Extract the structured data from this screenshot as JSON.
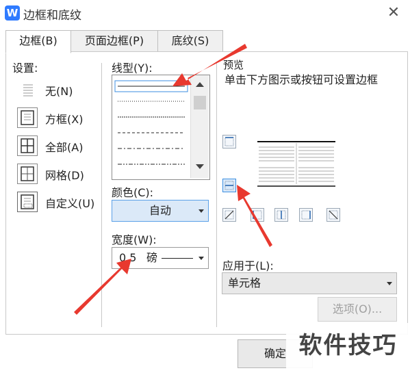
{
  "window": {
    "title": "边框和底纹",
    "app_icon_letter": "W"
  },
  "tabs": [
    {
      "label": "边框(B)",
      "active": true
    },
    {
      "label": "页面边框(P)",
      "active": false
    },
    {
      "label": "底纹(S)",
      "active": false
    }
  ],
  "settings": {
    "label": "设置:",
    "items": [
      {
        "label": "无(N)",
        "icon": "none-border-icon"
      },
      {
        "label": "方框(X)",
        "icon": "box-border-icon"
      },
      {
        "label": "全部(A)",
        "icon": "all-border-icon"
      },
      {
        "label": "网格(D)",
        "icon": "grid-border-icon"
      },
      {
        "label": "自定义(U)",
        "icon": "custom-border-icon"
      }
    ]
  },
  "line_style": {
    "label": "线型(Y):",
    "styles": [
      "solid",
      "dotted",
      "dashed-fine",
      "dashed",
      "dash-dot",
      "dash-dot-dot"
    ]
  },
  "color": {
    "label": "颜色(C):",
    "value": "自动"
  },
  "width": {
    "label": "宽度(W):",
    "value": "0.5",
    "unit": "磅"
  },
  "preview": {
    "label": "预览",
    "hint": "单击下方图示或按钮可设置边框"
  },
  "apply_to": {
    "label": "应用于(L):",
    "value": "单元格"
  },
  "buttons": {
    "options": "选项(O)...",
    "ok": "确定"
  },
  "watermark": "软件技巧",
  "colors": {
    "accent": "#2f7bff",
    "annotation_arrow": "#e8392f",
    "selected_button": "#d9e9fa"
  }
}
